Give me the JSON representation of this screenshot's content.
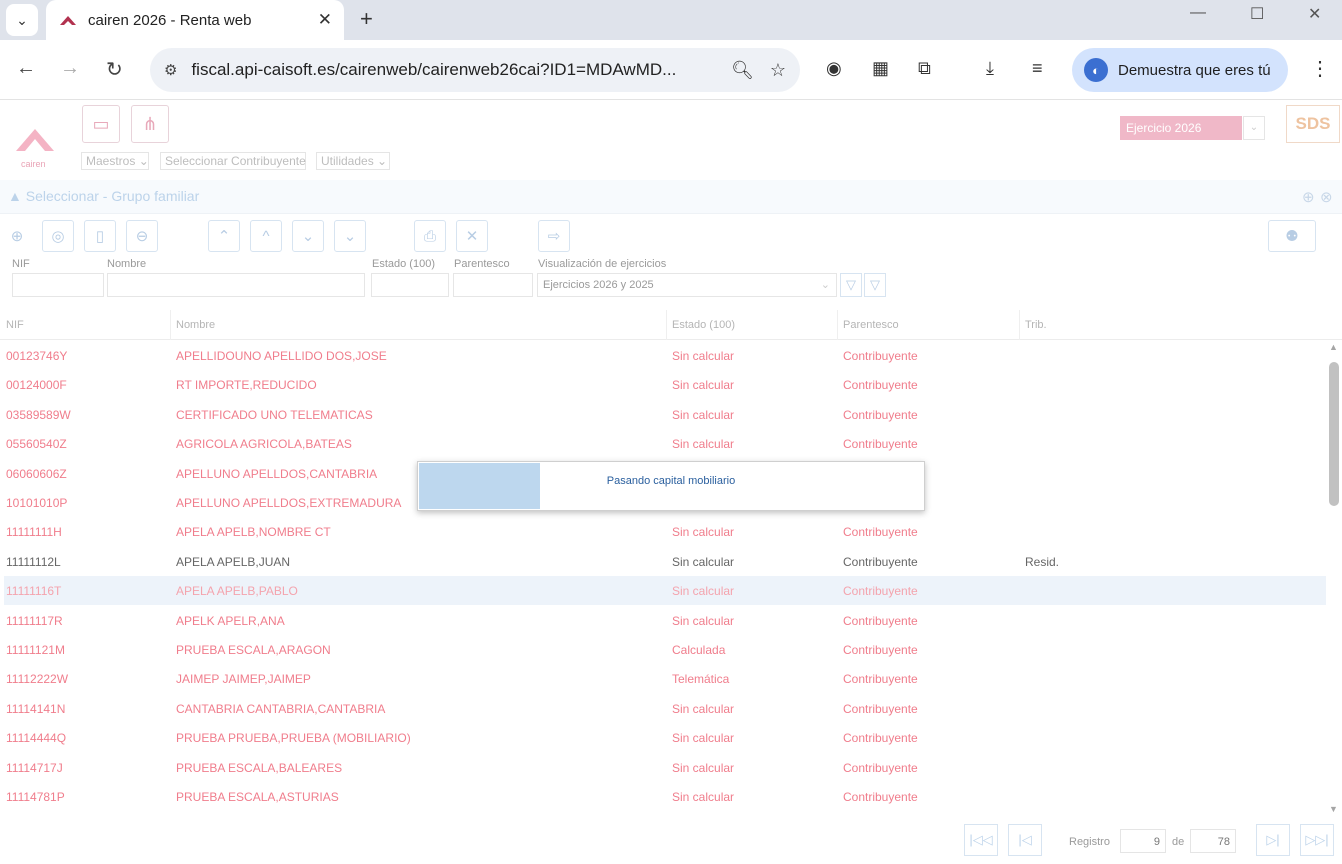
{
  "browser": {
    "tab_title": "cairen 2026 - Renta web",
    "url": "fiscal.api-caisoft.es/cairenweb/cairenweb26cai?ID1=MDAwMD...",
    "profile_label": "Demuestra que eres tú"
  },
  "app": {
    "logo_text": "cairen",
    "menus": [
      "Maestros",
      "Seleccionar Contribuyente",
      "Utilidades"
    ],
    "ejercicio": "Ejercicio 2026",
    "sds_label": "SDS",
    "section_title": "Seleccionar - Grupo familiar"
  },
  "filters": {
    "nif_label": "NIF",
    "nombre_label": "Nombre",
    "estado_label": "Estado (100)",
    "parentesco_label": "Parentesco",
    "visualizacion_label": "Visualización de ejercicios",
    "visualizacion_value": "Ejercicios 2026 y 2025"
  },
  "grid": {
    "columns": [
      "NIF",
      "Nombre",
      "Estado (100)",
      "Parentesco",
      "Trib."
    ],
    "rows": [
      {
        "nif": "00123746Y",
        "nombre": "APELLIDOUNO APELLIDO DOS,JOSE",
        "estado": "Sin calcular",
        "parentesco": "Contribuyente",
        "trib": ""
      },
      {
        "nif": "00124000F",
        "nombre": "RT IMPORTE,REDUCIDO",
        "estado": "Sin calcular",
        "parentesco": "Contribuyente",
        "trib": ""
      },
      {
        "nif": "03589589W",
        "nombre": "CERTIFICADO UNO TELEMATICAS",
        "estado": "Sin calcular",
        "parentesco": "Contribuyente",
        "trib": ""
      },
      {
        "nif": "05560540Z",
        "nombre": "AGRICOLA AGRICOLA,BATEAS",
        "estado": "Sin calcular",
        "parentesco": "Contribuyente",
        "trib": ""
      },
      {
        "nif": "06060606Z",
        "nombre": "APELLUNO APELLDOS,CANTABRIA",
        "estado": "",
        "parentesco": "",
        "trib": ""
      },
      {
        "nif": "10101010P",
        "nombre": "APELLUNO APELLDOS,EXTREMADURA",
        "estado": "",
        "parentesco": "",
        "trib": ""
      },
      {
        "nif": "11111111H",
        "nombre": "APELA APELB,NOMBRE CT",
        "estado": "Sin calcular",
        "parentesco": "Contribuyente",
        "trib": ""
      },
      {
        "nif": "11111112L",
        "nombre": "APELA APELB,JUAN",
        "estado": "Sin calcular",
        "parentesco": "Contribuyente",
        "trib": "Resid."
      },
      {
        "nif": "11111116T",
        "nombre": "APELA APELB,PABLO",
        "estado": "Sin calcular",
        "parentesco": "Contribuyente",
        "trib": ""
      },
      {
        "nif": "11111117R",
        "nombre": "APELK APELR,ANA",
        "estado": "Sin calcular",
        "parentesco": "Contribuyente",
        "trib": ""
      },
      {
        "nif": "11111121M",
        "nombre": "PRUEBA ESCALA,ARAGON",
        "estado": "Calculada",
        "parentesco": "Contribuyente",
        "trib": ""
      },
      {
        "nif": "11112222W",
        "nombre": "JAIMEP JAIMEP,JAIMEP",
        "estado": "Telemática",
        "parentesco": "Contribuyente",
        "trib": ""
      },
      {
        "nif": "11114141N",
        "nombre": "CANTABRIA CANTABRIA,CANTABRIA",
        "estado": "Sin calcular",
        "parentesco": "Contribuyente",
        "trib": ""
      },
      {
        "nif": "11114444Q",
        "nombre": "PRUEBA PRUEBA,PRUEBA (MOBILIARIO)",
        "estado": "Sin calcular",
        "parentesco": "Contribuyente",
        "trib": ""
      },
      {
        "nif": "11114717J",
        "nombre": "PRUEBA ESCALA,BALEARES",
        "estado": "Sin calcular",
        "parentesco": "Contribuyente",
        "trib": ""
      },
      {
        "nif": "11114781P",
        "nombre": "PRUEBA ESCALA,ASTURIAS",
        "estado": "Sin calcular",
        "parentesco": "Contribuyente",
        "trib": ""
      }
    ],
    "selected_row": 8,
    "dark_row": 7
  },
  "progress": {
    "message": "Pasando capital mobiliario",
    "fraction": 0.24
  },
  "pager": {
    "registro_label": "Registro",
    "registro_value": "9",
    "de_label": "de",
    "total_value": "78"
  },
  "colors": {
    "accent": "#f07d8c",
    "selected_row": "#edf3fa",
    "progress_fill": "#bdd7ee"
  }
}
